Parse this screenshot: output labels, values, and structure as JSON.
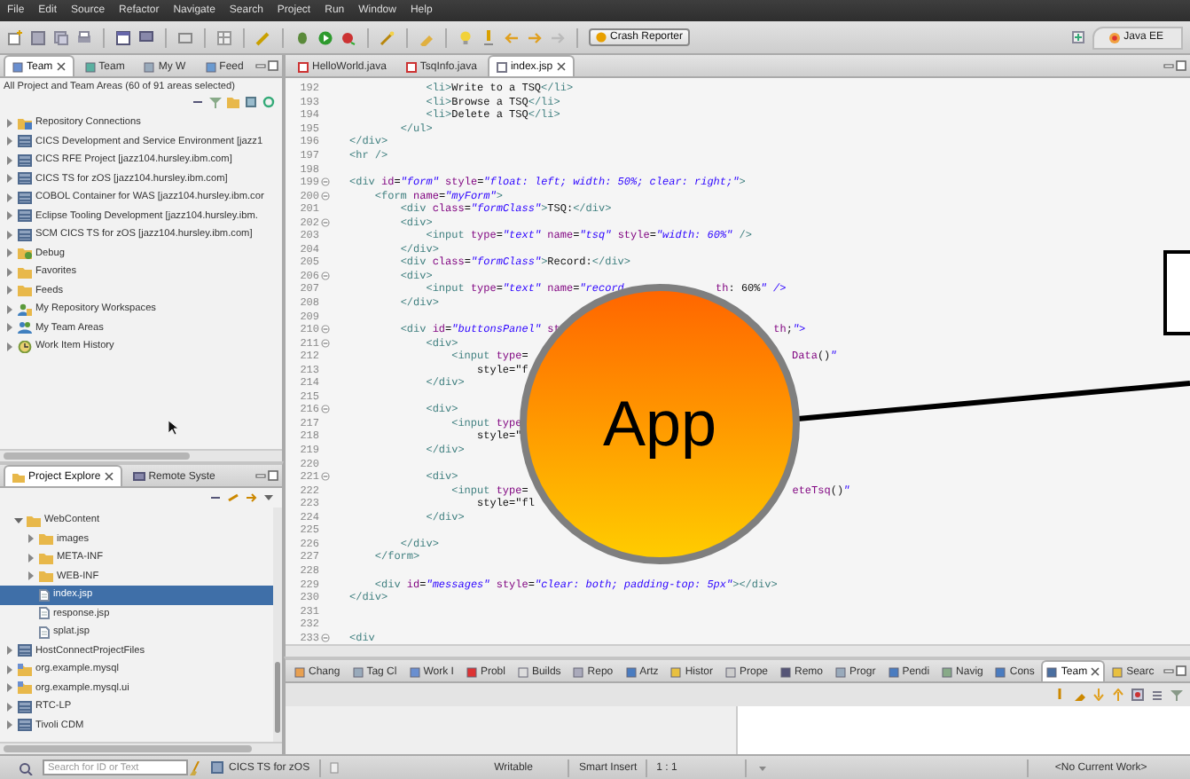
{
  "menu_bar": [
    "File",
    "Edit",
    "Source",
    "Refactor",
    "Navigate",
    "Search",
    "Project",
    "Run",
    "Window",
    "Help"
  ],
  "toolbar": {
    "crash_button": "Crash Reporter",
    "perspective": "Java EE"
  },
  "team_view": {
    "tabs": [
      {
        "label": "Team",
        "selected": true
      },
      {
        "label": "Team",
        "selected": false
      },
      {
        "label": "My W",
        "selected": false
      },
      {
        "label": "Feed",
        "selected": false
      }
    ],
    "summary": "All Project and Team Areas (60 of 91 areas selected)",
    "items": [
      {
        "label": "Repository Connections",
        "kind": "repo",
        "expanded": false
      },
      {
        "label": "CICS Development and Service Environment [jazz1",
        "kind": "project",
        "expanded": false
      },
      {
        "label": "CICS RFE Project [jazz104.hursley.ibm.com]",
        "kind": "project",
        "expanded": false
      },
      {
        "label": "CICS TS for zOS [jazz104.hursley.ibm.com]",
        "kind": "project",
        "expanded": false
      },
      {
        "label": "COBOL Container for WAS [jazz104.hursley.ibm.cor",
        "kind": "project",
        "expanded": false
      },
      {
        "label": "Eclipse Tooling Development [jazz104.hursley.ibm.",
        "kind": "project",
        "expanded": false
      },
      {
        "label": "SCM CICS TS for zOS [jazz104.hursley.ibm.com]",
        "kind": "project",
        "expanded": false
      },
      {
        "label": "Debug",
        "kind": "debug",
        "expanded": false
      },
      {
        "label": "Favorites",
        "kind": "folder",
        "expanded": false
      },
      {
        "label": "Feeds",
        "kind": "folder",
        "expanded": false
      },
      {
        "label": "My Repository Workspaces",
        "kind": "workspace",
        "expanded": false
      },
      {
        "label": "My Team Areas",
        "kind": "team",
        "expanded": false
      },
      {
        "label": "Work Item History",
        "kind": "history",
        "expanded": false
      }
    ]
  },
  "project_explorer": {
    "tabs": [
      {
        "label": "Project Explore",
        "selected": true
      },
      {
        "label": "Remote Syste",
        "selected": false
      }
    ],
    "tree": [
      {
        "label": "WebContent",
        "kind": "folder",
        "expanded": true,
        "selected": false,
        "children": [
          {
            "label": "images",
            "kind": "folder",
            "expanded": false,
            "selected": false
          },
          {
            "label": "META-INF",
            "kind": "folder",
            "expanded": false,
            "selected": false
          },
          {
            "label": "WEB-INF",
            "kind": "folder",
            "expanded": false,
            "selected": false
          },
          {
            "label": "index.jsp",
            "kind": "file",
            "selected": true
          },
          {
            "label": "response.jsp",
            "kind": "file",
            "selected": false
          },
          {
            "label": "splat.jsp",
            "kind": "file",
            "selected": false
          }
        ]
      },
      {
        "label": "HostConnectProjectFiles",
        "kind": "project",
        "expanded": false,
        "selected": false
      },
      {
        "label": "org.example.mysql",
        "kind": "javaproject",
        "expanded": false,
        "selected": false
      },
      {
        "label": "org.example.mysql.ui",
        "kind": "javaproject",
        "expanded": false,
        "selected": false
      },
      {
        "label": "RTC-LP",
        "kind": "project",
        "expanded": false,
        "selected": false
      },
      {
        "label": "Tivoli CDM",
        "kind": "project",
        "expanded": false,
        "selected": false
      }
    ]
  },
  "editor": {
    "tabs": [
      {
        "label": "HelloWorld.java",
        "selected": false
      },
      {
        "label": "TsqInfo.java",
        "selected": false
      },
      {
        "label": "index.jsp",
        "selected": true
      }
    ],
    "lines": [
      {
        "num": "192",
        "text": "            <li>Write to a TSQ</li>"
      },
      {
        "num": "193",
        "text": "            <li>Browse a TSQ</li>"
      },
      {
        "num": "194",
        "text": "            <li>Delete a TSQ</li>"
      },
      {
        "num": "195",
        "text": "        </ul>"
      },
      {
        "num": "196",
        "text": "</div>"
      },
      {
        "num": "197",
        "text": "<hr />"
      },
      {
        "num": "198"
      },
      {
        "num": "199",
        "text": "<div id=\"form\" style=\"float: left; width: 50%; clear: right;\">",
        "fold": true
      },
      {
        "num": "200",
        "text": "    <form name=\"myForm\">",
        "fold": true
      },
      {
        "num": "201",
        "text": "        <div class=\"formClass\">TSQ:</div>"
      },
      {
        "num": "202",
        "text": "        <div>",
        "fold": true
      },
      {
        "num": "203",
        "text": "            <input type=\"text\" name=\"tsq\" style=\"width: 60%\" />"
      },
      {
        "num": "204",
        "text": "        </div>"
      },
      {
        "num": "205",
        "text": "        <div class=\"formClass\">Record:</div>"
      },
      {
        "num": "206",
        "text": "        <div>",
        "fold": true
      },
      {
        "num": "207",
        "text": "            <input type=\"text\" name=\"record",
        "tail": "th: 60%\" />"
      },
      {
        "num": "208",
        "text": "        </div>"
      },
      {
        "num": "209"
      },
      {
        "num": "210",
        "text": "        <div id=\"buttonsPanel\" st",
        "tail": "th;\">",
        "fold": true
      },
      {
        "num": "211",
        "text": "            <div>",
        "fold": true
      },
      {
        "num": "212",
        "text": "                <input type=",
        "tail": "Data()\""
      },
      {
        "num": "213",
        "text": "                    style=\"f"
      },
      {
        "num": "214",
        "text": "            </div>"
      },
      {
        "num": "215"
      },
      {
        "num": "216",
        "text": "            <div>",
        "fold": true
      },
      {
        "num": "217",
        "text": "                <input type"
      },
      {
        "num": "218",
        "text": "                    style=\""
      },
      {
        "num": "219",
        "text": "            </div>"
      },
      {
        "num": "220"
      },
      {
        "num": "221",
        "text": "            <div>",
        "fold": true
      },
      {
        "num": "222",
        "text": "                <input type=",
        "tail": "eteTsq()\""
      },
      {
        "num": "223",
        "text": "                    style=\"fl"
      },
      {
        "num": "224",
        "text": "            </div>"
      },
      {
        "num": "225"
      },
      {
        "num": "226",
        "text": "        </div>"
      },
      {
        "num": "227",
        "text": "    </form>"
      },
      {
        "num": "228"
      },
      {
        "num": "229",
        "text": "    <div id=\"messages\" style=\"clear: both; padding-top: 5px\"></div>"
      },
      {
        "num": "230",
        "text": "</div>"
      },
      {
        "num": "231"
      },
      {
        "num": "232"
      },
      {
        "num": "233",
        "text": "<div",
        "fold": true
      }
    ]
  },
  "overlay": {
    "label": "App"
  },
  "bottom_panel": {
    "tabs": [
      {
        "label": "Chang",
        "selected": false
      },
      {
        "label": "Tag Cl",
        "selected": false
      },
      {
        "label": "Work I",
        "selected": false
      },
      {
        "label": "Probl",
        "selected": false
      },
      {
        "label": "Builds",
        "selected": false
      },
      {
        "label": "Repo",
        "selected": false
      },
      {
        "label": "Artz",
        "selected": false
      },
      {
        "label": "Histor",
        "selected": false
      },
      {
        "label": "Prope",
        "selected": false
      },
      {
        "label": "Remo",
        "selected": false
      },
      {
        "label": "Progr",
        "selected": false
      },
      {
        "label": "Pendi",
        "selected": false
      },
      {
        "label": "Navig",
        "selected": false
      },
      {
        "label": "Cons",
        "selected": false
      },
      {
        "label": "Team",
        "selected": true
      },
      {
        "label": "Searc",
        "selected": false
      }
    ]
  },
  "status_bar": {
    "search_placeholder": "Search for ID or Text",
    "connection": "CICS TS for zOS",
    "mode": "Writable",
    "insert": "Smart Insert",
    "position": "1 : 1",
    "work": "<No Current Work>"
  }
}
